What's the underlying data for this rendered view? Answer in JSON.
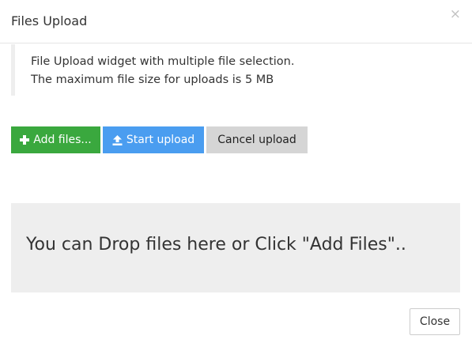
{
  "dialog": {
    "title": "Files Upload",
    "close_glyph": "×"
  },
  "info": {
    "line1": "File Upload widget with multiple file selection.",
    "line2": "The maximum file size for uploads is 5 MB"
  },
  "toolbar": {
    "add_label": "Add files...",
    "add_icon": "plus-icon",
    "start_label": "Start upload",
    "start_icon": "upload-icon",
    "cancel_label": "Cancel upload"
  },
  "dropzone": {
    "text": "You can Drop files here or Click \"Add Files\".."
  },
  "footer": {
    "close_label": "Close"
  },
  "colors": {
    "add_button": "#3aa83e",
    "start_button": "#4a9df0",
    "cancel_button": "#d5d5d5",
    "drop_zone": "#eeeeee"
  }
}
